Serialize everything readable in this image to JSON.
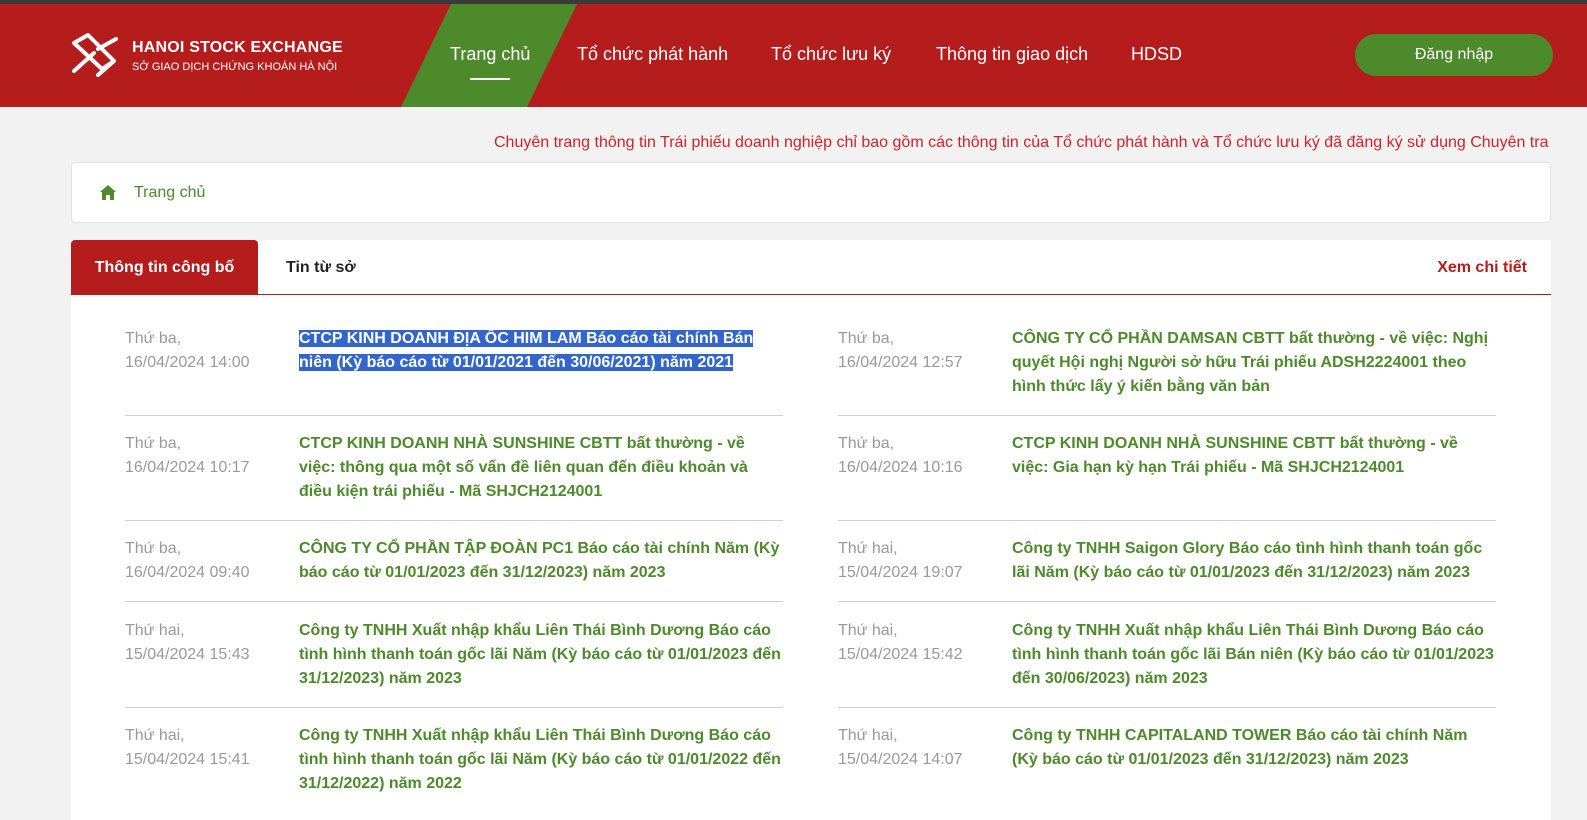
{
  "brand": {
    "name": "HANOI STOCK EXCHANGE",
    "subtitle": "SỞ GIAO DỊCH CHỨNG KHOÁN HÀ NỘI"
  },
  "nav": {
    "items": [
      "Trang chủ",
      "Tổ chức phát hành",
      "Tổ chức lưu ký",
      "Thông tin giao dịch",
      "HDSD"
    ],
    "active_index": 0,
    "login_label": "Đăng nhập"
  },
  "colors": {
    "primary_red": "#b51d1d",
    "accent_green": "#4d8a2c",
    "marquee_red": "#d4212a",
    "selection": "#3366cc"
  },
  "marquee_text": "Chuyên trang thông tin Trái phiếu doanh nghiệp chỉ bao gồm các thông tin của Tổ chức phát hành và Tổ chức lưu ký đã đăng ký sử dụng Chuyên tra",
  "breadcrumb": {
    "icon": "home-icon",
    "label": "Trang chủ"
  },
  "tabs": {
    "active": "Thông tin công bố",
    "other": "Tin từ sở",
    "view_detail": "Xem chi tiết"
  },
  "news": {
    "left": [
      {
        "day": "Thứ ba,",
        "datetime": "16/04/2024 14:00",
        "title_lines": [
          "CTCP KINH DOANH ĐỊA ỐC HIM LAM Báo cáo tài chính Bán",
          "niên (Kỳ báo cáo từ 01/01/2021 đến 30/06/2021) năm 2021"
        ],
        "selected": true
      },
      {
        "day": "Thứ ba,",
        "datetime": "16/04/2024 10:17",
        "title_lines": [
          "CTCP KINH DOANH NHÀ SUNSHINE CBTT bất thường - về",
          "việc: thông qua một số vấn đề liên quan đến điều khoản và",
          "điều kiện trái phiếu - Mã SHJCH2124001"
        ]
      },
      {
        "day": "Thứ ba,",
        "datetime": "16/04/2024 09:40",
        "title_lines": [
          "CÔNG TY CỔ PHẦN TẬP ĐOÀN PC1 Báo cáo tài chính Năm (Kỳ",
          "báo cáo từ 01/01/2023 đến 31/12/2023) năm 2023"
        ]
      },
      {
        "day": "Thứ hai,",
        "datetime": "15/04/2024 15:43",
        "title_lines": [
          "Công ty TNHH Xuất nhập khẩu Liên Thái Bình Dương Báo cáo",
          "tình hình thanh toán gốc lãi Năm (Kỳ báo cáo từ 01/01/2023 đến",
          "31/12/2023) năm 2023"
        ]
      },
      {
        "day": "Thứ hai,",
        "datetime": "15/04/2024 15:41",
        "title_lines": [
          "Công ty TNHH Xuất nhập khẩu Liên Thái Bình Dương Báo cáo",
          "tình hình thanh toán gốc lãi Năm (Kỳ báo cáo từ 01/01/2022 đến",
          "31/12/2022) năm 2022"
        ]
      }
    ],
    "right": [
      {
        "day": "Thứ ba,",
        "datetime": "16/04/2024 12:57",
        "title_lines": [
          "CÔNG TY CỔ PHẦN DAMSAN CBTT bất thường - về việc: Nghị",
          "quyết Hội nghị Người sở hữu Trái phiếu ADSH2224001 theo",
          "hình thức lấy ý kiến bằng văn bản"
        ]
      },
      {
        "day": "Thứ ba,",
        "datetime": "16/04/2024 10:16",
        "title_lines": [
          "CTCP KINH DOANH NHÀ SUNSHINE CBTT bất thường - về",
          "việc: Gia hạn kỳ hạn Trái phiếu - Mã SHJCH2124001"
        ]
      },
      {
        "day": "Thứ hai,",
        "datetime": "15/04/2024 19:07",
        "title_lines": [
          "Công ty TNHH Saigon Glory Báo cáo tình hình thanh toán gốc",
          "lãi Năm (Kỳ báo cáo từ 01/01/2023 đến 31/12/2023) năm 2023"
        ]
      },
      {
        "day": "Thứ hai,",
        "datetime": "15/04/2024 15:42",
        "title_lines": [
          "Công ty TNHH Xuất nhập khẩu Liên Thái Bình Dương Báo cáo",
          "tình hình thanh toán gốc lãi Bán niên (Kỳ báo cáo từ 01/01/2023",
          "đến 30/06/2023) năm 2023"
        ]
      },
      {
        "day": "Thứ hai,",
        "datetime": "15/04/2024 14:07",
        "title_lines": [
          "Công ty TNHH CAPITALAND TOWER Báo cáo tài chính Năm",
          "(Kỳ báo cáo từ 01/01/2023 đến 31/12/2023) năm 2023"
        ]
      }
    ]
  }
}
